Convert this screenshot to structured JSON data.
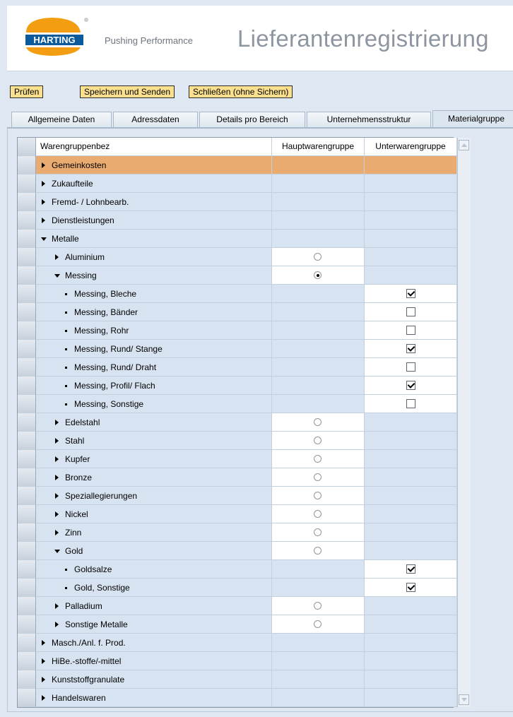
{
  "header": {
    "logo_text": "HARTING",
    "slogan": "Pushing Performance",
    "title": "Lieferantenregistrierung"
  },
  "toolbar": {
    "check_label": "Prüfen",
    "save_send_label": "Speichern und Senden",
    "close_label": "Schließen (ohne Sichern)"
  },
  "tabs": [
    {
      "label": "Allgemeine Daten"
    },
    {
      "label": "Adressdaten"
    },
    {
      "label": "Details pro Bereich"
    },
    {
      "label": "Unternehmensstruktur"
    },
    {
      "label": "Materialgruppe"
    }
  ],
  "table": {
    "headers": {
      "name": "Warengruppenbez",
      "haupt": "Hauptwarengruppe",
      "unter": "Unterwarengruppe"
    },
    "rows": [
      {
        "label": "Gemeinkosten",
        "level": 0,
        "icon": "expand",
        "highlight": true
      },
      {
        "label": "Zukaufteile",
        "level": 0,
        "icon": "expand"
      },
      {
        "label": "Fremd- / Lohnbearb.",
        "level": 0,
        "icon": "expand"
      },
      {
        "label": "Dienstleistungen",
        "level": 0,
        "icon": "expand"
      },
      {
        "label": "Metalle",
        "level": 0,
        "icon": "collapse"
      },
      {
        "label": "Aluminium",
        "level": 1,
        "icon": "expand",
        "radio": false
      },
      {
        "label": "Messing",
        "level": 1,
        "icon": "collapse",
        "radio": true
      },
      {
        "label": "Messing, Bleche",
        "level": 2,
        "icon": "leaf",
        "check": true
      },
      {
        "label": "Messing, Bänder",
        "level": 2,
        "icon": "leaf",
        "check": false
      },
      {
        "label": "Messing, Rohr",
        "level": 2,
        "icon": "leaf",
        "check": false
      },
      {
        "label": "Messing, Rund/ Stange",
        "level": 2,
        "icon": "leaf",
        "check": true
      },
      {
        "label": "Messing, Rund/ Draht",
        "level": 2,
        "icon": "leaf",
        "check": false
      },
      {
        "label": "Messing, Profil/ Flach",
        "level": 2,
        "icon": "leaf",
        "check": true
      },
      {
        "label": "Messing, Sonstige",
        "level": 2,
        "icon": "leaf",
        "check": false
      },
      {
        "label": "Edelstahl",
        "level": 1,
        "icon": "expand",
        "radio": false
      },
      {
        "label": "Stahl",
        "level": 1,
        "icon": "expand",
        "radio": false
      },
      {
        "label": "Kupfer",
        "level": 1,
        "icon": "expand",
        "radio": false
      },
      {
        "label": "Bronze",
        "level": 1,
        "icon": "expand",
        "radio": false
      },
      {
        "label": "Speziallegierungen",
        "level": 1,
        "icon": "expand",
        "radio": false
      },
      {
        "label": "Nickel",
        "level": 1,
        "icon": "expand",
        "radio": false
      },
      {
        "label": "Zinn",
        "level": 1,
        "icon": "expand",
        "radio": false
      },
      {
        "label": "Gold",
        "level": 1,
        "icon": "collapse",
        "radio": false
      },
      {
        "label": "Goldsalze",
        "level": 2,
        "icon": "leaf",
        "check": true
      },
      {
        "label": "Gold, Sonstige",
        "level": 2,
        "icon": "leaf",
        "check": true
      },
      {
        "label": "Palladium",
        "level": 1,
        "icon": "expand",
        "radio": false
      },
      {
        "label": "Sonstige Metalle",
        "level": 1,
        "icon": "expand",
        "radio": false
      },
      {
        "label": "Masch./Anl. f. Prod.",
        "level": 0,
        "icon": "expand"
      },
      {
        "label": "HiBe.-stoffe/-mittel",
        "level": 0,
        "icon": "expand"
      },
      {
        "label": "Kunststoffgranulate",
        "level": 0,
        "icon": "expand"
      },
      {
        "label": "Handelswaren",
        "level": 0,
        "icon": "expand"
      }
    ]
  },
  "colors": {
    "button_bg": "#fae08e",
    "highlight_row": "#eaab70",
    "row_bg": "#d7e3f0",
    "logo_orange": "#f29d12",
    "logo_blue": "#0a5a9c"
  }
}
